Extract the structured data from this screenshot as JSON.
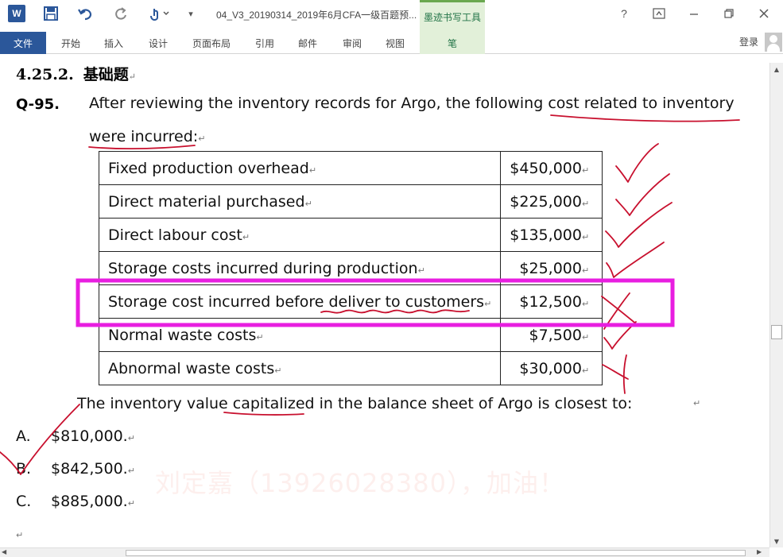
{
  "titlebar": {
    "doc_title": "04_V3_20190314_2019年6月CFA一级百题预...",
    "context_tab_title": "墨迹书写工具",
    "help": "?",
    "icons": [
      "word-icon",
      "save-icon",
      "undo-icon",
      "redo-icon",
      "touch-mode-icon",
      "customize-qat-icon",
      "ribbon-display-options-icon",
      "minimize-icon",
      "restore-icon",
      "close-icon"
    ]
  },
  "ribbon": {
    "tabs": [
      "文件",
      "开始",
      "插入",
      "设计",
      "页面布局",
      "引用",
      "邮件",
      "审阅",
      "视图",
      "笔"
    ],
    "login": "登录",
    "colors": {
      "file_tab": "#2b579a",
      "pen_tab": "#e2f0d9"
    }
  },
  "document": {
    "heading_number": "4.25.2.",
    "heading_title": "基础题",
    "paragraph_mark": "↵",
    "question_number": "Q-95.",
    "question_line1": "After reviewing the inventory records for Argo, the following cost related to inventory",
    "question_line2": "were incurred:",
    "table": [
      {
        "item": "Fixed production overhead",
        "amount": "$450,000"
      },
      {
        "item": "Direct material purchased",
        "amount": "$225,000"
      },
      {
        "item": "Direct labour cost",
        "amount": "$135,000"
      },
      {
        "item": "Storage costs incurred during production",
        "amount": "$25,000"
      },
      {
        "item": "Storage cost incurred before deliver to customers",
        "amount": "$12,500"
      },
      {
        "item": "Normal waste costs",
        "amount": "$7,500"
      },
      {
        "item": "Abnormal waste costs",
        "amount": "$30,000"
      }
    ],
    "prompt": "The inventory value capitalized in the balance sheet of Argo is closest to:",
    "options": [
      {
        "letter": "A.",
        "text": "$810,000."
      },
      {
        "letter": "B.",
        "text": "$842,500."
      },
      {
        "letter": "C.",
        "text": "$885,000."
      }
    ],
    "watermark": "刘定嘉（13926028380），加油！",
    "annotation_colors": {
      "pen_red": "#c8102e",
      "highlight_box": "#e81ee0"
    }
  }
}
